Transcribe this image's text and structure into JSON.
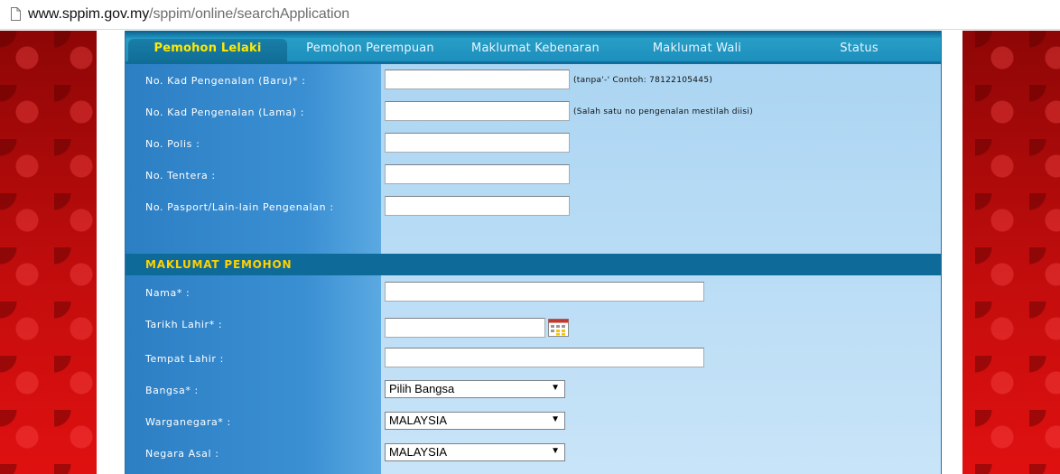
{
  "browser": {
    "url_host": "www.sppim.gov.my",
    "url_path": "/sppim/online/searchApplication"
  },
  "tabs": [
    {
      "label": "Pemohon Lelaki",
      "active": true
    },
    {
      "label": "Pemohon Perempuan",
      "active": false
    },
    {
      "label": "Maklumat Kebenaran",
      "active": false
    },
    {
      "label": "Maklumat Wali",
      "active": false
    },
    {
      "label": "Status",
      "active": false
    }
  ],
  "identity": {
    "ic_new_label": "No. Kad Pengenalan (Baru)* :",
    "ic_new_value": "",
    "ic_new_hint": "(tanpa'-' Contoh: 78122105445)",
    "ic_old_label": "No. Kad Pengenalan (Lama) :",
    "ic_old_value": "",
    "ic_old_hint": "(Salah satu no pengenalan mestilah diisi)",
    "police_label": "No. Polis :",
    "police_value": "",
    "army_label": "No. Tentera :",
    "army_value": "",
    "passport_label": "No. Pasport/Lain-lain Pengenalan :",
    "passport_value": ""
  },
  "applicant": {
    "section_title": "MAKLUMAT PEMOHON",
    "name_label": "Nama* :",
    "name_value": "",
    "dob_label": "Tarikh Lahir* :",
    "dob_value": "",
    "pob_label": "Tempat Lahir :",
    "pob_value": "",
    "race_label": "Bangsa* :",
    "race_selected": "Pilih Bangsa",
    "citizenship_label": "Warganegara* :",
    "citizenship_selected": "MALAYSIA",
    "origin_label": "Negara Asal :",
    "origin_selected": "MALAYSIA"
  },
  "icons": {
    "page": "page-icon",
    "calendar": "calendar-icon",
    "dropdown": "chevron-down-icon"
  },
  "colors": {
    "accent_yellow": "#ffea00",
    "section_bar": "#0e6a99",
    "tab_bar": "#1d8fbd",
    "label_column": "#2d7fc4",
    "background_red": "#b40a0a"
  }
}
